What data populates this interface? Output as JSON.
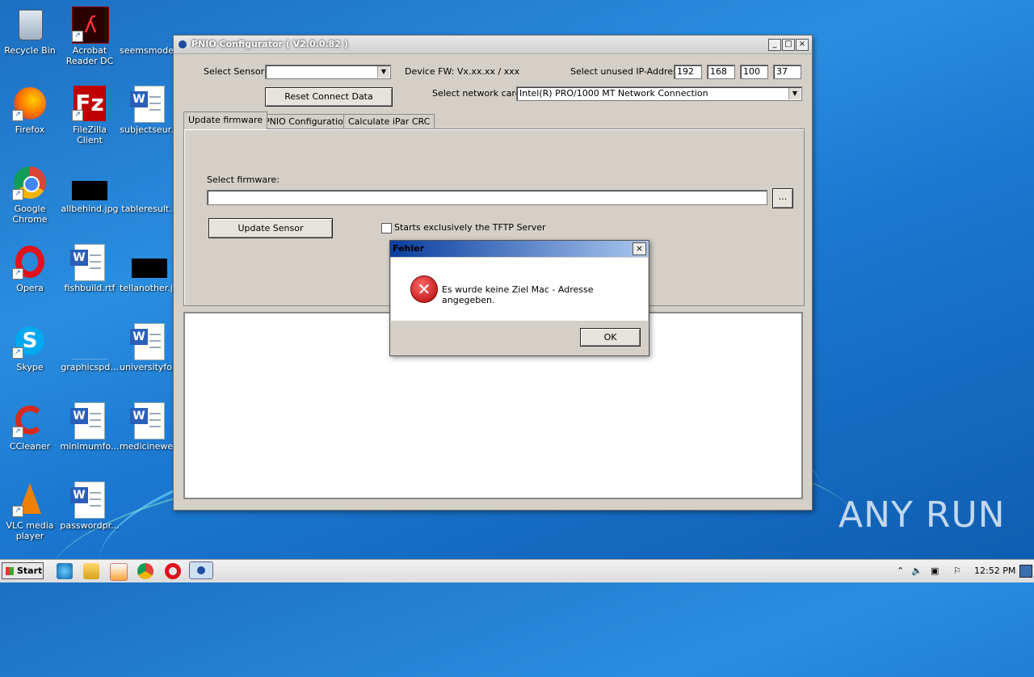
{
  "desktop": {
    "icons": [
      {
        "label": "Recycle Bin"
      },
      {
        "label": "Acrobat Reader DC"
      },
      {
        "label": "seemsmode..."
      },
      {
        "label": "Firefox"
      },
      {
        "label": "FileZilla Client"
      },
      {
        "label": "subjectseur..."
      },
      {
        "label": "Google Chrome"
      },
      {
        "label": "allbehind.jpg"
      },
      {
        "label": "tableresult..."
      },
      {
        "label": "Opera"
      },
      {
        "label": "fishbuild.rtf"
      },
      {
        "label": "tellanother.jpg"
      },
      {
        "label": "Skype"
      },
      {
        "label": "graphicspd..."
      },
      {
        "label": "universityfo..."
      },
      {
        "label": "CCleaner"
      },
      {
        "label": "minimumfo..."
      },
      {
        "label": "medicinewe..."
      },
      {
        "label": "VLC media player"
      },
      {
        "label": "passwordpr..."
      }
    ]
  },
  "window": {
    "title": "PNIO Configurator ( V2.0.0.82 )",
    "min": "_",
    "max": "□",
    "close": "×",
    "select_sensor_label": "Select Sensor:",
    "select_sensor_value": "",
    "device_fw": "Device FW: Vx.xx.xx / xxx",
    "ip_label": "Select unused IP-Addres:",
    "ip": [
      "192",
      "168",
      "100",
      "37"
    ],
    "reset_button": "Reset Connect Data",
    "network_label": "Select network card:",
    "network_value": "Intel(R) PRO/1000 MT Network Connection",
    "tabs": [
      "Update firmware",
      "PNIO Configuration",
      "Calculate iPar CRC"
    ],
    "firmware_label": "Select firmware:",
    "firmware_value": "",
    "browse_button": "...",
    "update_button": "Update Sensor",
    "tftp_checkbox_label": "Starts exclusively the TFTP Server",
    "tftp_checked": false
  },
  "dialog": {
    "title": "Fehler",
    "close": "×",
    "message": "Es wurde keine Ziel Mac - Adresse angegeben.",
    "icon": "error-icon",
    "ok": "OK"
  },
  "taskbar": {
    "start": "Start",
    "clock": "12:52 PM",
    "pinned": [
      "internet-explorer-icon",
      "explorer-icon",
      "media-player-icon",
      "chrome-icon",
      "opera-icon",
      "pnio-configurator-icon"
    ]
  },
  "watermark": "ANY RUN"
}
